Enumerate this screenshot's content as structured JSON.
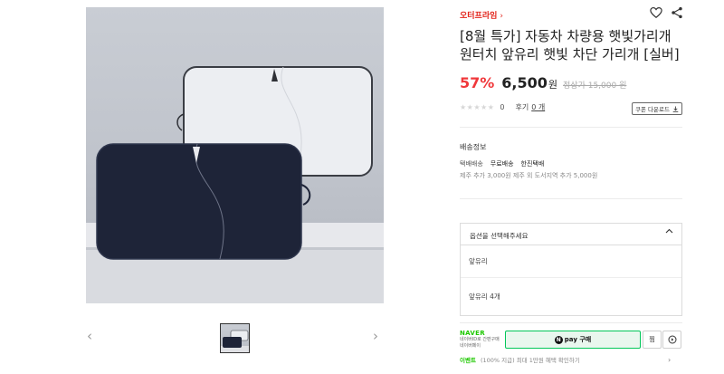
{
  "store": {
    "name": "오터프라임",
    "chevron": "›"
  },
  "product": {
    "title": "[8월 특가] 자동차 차량용 햇빛가리개 원터치 앞유리 햇빛 차단 가리개 [실버]",
    "discount": "57%",
    "sale_price": "6,500",
    "won": "원",
    "original_price": "정상가 15,000 원"
  },
  "rating": {
    "stars": "★★★★★",
    "score": "0",
    "review_label": "후기",
    "review_count": "0 개"
  },
  "coupon": {
    "label": "쿠폰 다운로드",
    "icon": "download-icon"
  },
  "shipping": {
    "heading": "배송정보",
    "type": "택배배송",
    "fee": "무료배송",
    "carrier": "한진택배",
    "extra": "제주 추가 3,000원 제주 외 도서지역 추가 5,000원"
  },
  "options": {
    "placeholder": "옵션을 선택해주세요",
    "items": [
      "앞유리",
      "앞유리 4개"
    ]
  },
  "naver": {
    "logo": "NAVER",
    "sub1": "네이버ID로 간편구매",
    "sub2": "네이버페이",
    "pay_label": "pay 구매",
    "pay_mark": "N",
    "zzim_label": "찜",
    "talk_icon": "chat-icon"
  },
  "event": {
    "label": "이벤트",
    "text": "(100% 지급) 최대 1만원 혜택 확인하기",
    "more": "›"
  },
  "gallery": {
    "prev": "‹",
    "next": "›"
  },
  "colors": {
    "accent": "#e2231a",
    "discount": "#f0383b",
    "naver_green": "#03c75a"
  }
}
